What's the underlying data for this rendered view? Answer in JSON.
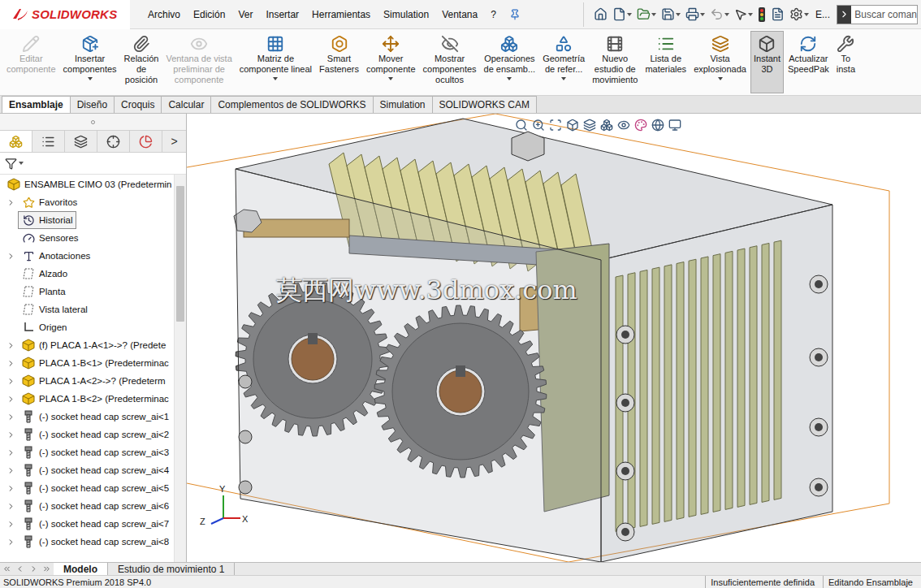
{
  "app": {
    "logo": "SOLIDWORKS"
  },
  "menu": [
    "Archivo",
    "Edición",
    "Ver",
    "Insertar",
    "Herramientas",
    "Simulation",
    "Ventana",
    "?"
  ],
  "quick_access": {
    "overflow_label": "E..."
  },
  "search": {
    "placeholder": "Buscar coman"
  },
  "ribbon": [
    {
      "lines": [
        "Editar",
        "componente"
      ],
      "disabled": true,
      "dropdown": false,
      "selected": false
    },
    {
      "lines": [
        "Insertar",
        "componentes"
      ],
      "disabled": false,
      "dropdown": true,
      "selected": false
    },
    {
      "lines": [
        "Relación",
        "de",
        "posición"
      ],
      "disabled": false,
      "dropdown": false,
      "selected": false
    },
    {
      "lines": [
        "Ventana de vista",
        "preliminar de",
        "componente"
      ],
      "disabled": true,
      "dropdown": false,
      "selected": false
    },
    {
      "lines": [
        "Matriz de",
        "componente lineal"
      ],
      "disabled": false,
      "dropdown": true,
      "selected": false
    },
    {
      "lines": [
        "Smart",
        "Fasteners"
      ],
      "disabled": false,
      "dropdown": false,
      "selected": false
    },
    {
      "lines": [
        "Mover",
        "componente"
      ],
      "disabled": false,
      "dropdown": true,
      "selected": false
    },
    {
      "lines": [
        "Mostrar",
        "componentes",
        "ocultos"
      ],
      "disabled": false,
      "dropdown": false,
      "selected": false
    },
    {
      "lines": [
        "Operaciones",
        "de ensamb..."
      ],
      "disabled": false,
      "dropdown": true,
      "selected": false
    },
    {
      "lines": [
        "Geometría",
        "de refer..."
      ],
      "disabled": false,
      "dropdown": true,
      "selected": false
    },
    {
      "lines": [
        "Nuevo",
        "estudio de",
        "movimiento"
      ],
      "disabled": false,
      "dropdown": false,
      "selected": false
    },
    {
      "lines": [
        "Lista de",
        "materiales"
      ],
      "disabled": false,
      "dropdown": false,
      "selected": false
    },
    {
      "lines": [
        "Vista",
        "explosionada"
      ],
      "disabled": false,
      "dropdown": true,
      "selected": false
    },
    {
      "lines": [
        "Instant",
        "3D"
      ],
      "disabled": false,
      "dropdown": false,
      "selected": true
    },
    {
      "lines": [
        "Actualizar",
        "SpeedPak"
      ],
      "disabled": false,
      "dropdown": false,
      "selected": false
    },
    {
      "lines": [
        "To",
        "insta"
      ],
      "disabled": false,
      "dropdown": false,
      "selected": false
    }
  ],
  "tabs": [
    {
      "label": "Ensamblaje",
      "selected": true
    },
    {
      "label": "Diseño",
      "selected": false
    },
    {
      "label": "Croquis",
      "selected": false
    },
    {
      "label": "Calcular",
      "selected": false
    },
    {
      "label": "Complementos de SOLIDWORKS",
      "selected": false
    },
    {
      "label": "Simulation",
      "selected": false
    },
    {
      "label": "SOLIDWORKS CAM",
      "selected": false
    }
  ],
  "panel": {
    "tabs": [
      {
        "selected": true
      },
      {
        "selected": false
      },
      {
        "selected": false
      },
      {
        "selected": false
      },
      {
        "selected": false
      }
    ],
    "more": ">",
    "scroll": {
      "level": 0.36
    },
    "tree": [
      {
        "label": "ENSAMBLE CIMO 03  (Predetermin",
        "kind": "assembly",
        "expandable": false,
        "selected": false
      },
      {
        "label": "Favoritos",
        "kind": "favorites",
        "expandable": true,
        "selected": false
      },
      {
        "label": "Historial",
        "kind": "history",
        "expandable": false,
        "selected": true
      },
      {
        "label": "Sensores",
        "kind": "sensors",
        "expandable": false,
        "selected": false
      },
      {
        "label": "Anotaciones",
        "kind": "annotations",
        "expandable": true,
        "selected": false
      },
      {
        "label": "Alzado",
        "kind": "plane",
        "expandable": false,
        "selected": false
      },
      {
        "label": "Planta",
        "kind": "plane",
        "expandable": false,
        "selected": false
      },
      {
        "label": "Vista lateral",
        "kind": "plane",
        "expandable": false,
        "selected": false
      },
      {
        "label": "Origen",
        "kind": "origin",
        "expandable": false,
        "selected": false
      },
      {
        "label": "(f) PLACA 1-A<1>->? (Predete",
        "kind": "part",
        "expandable": true,
        "selected": false
      },
      {
        "label": "PLACA 1-B<1> (Predeterminac",
        "kind": "part",
        "expandable": true,
        "selected": false
      },
      {
        "label": "PLACA 1-A<2>->? (Predeterm",
        "kind": "part",
        "expandable": true,
        "selected": false
      },
      {
        "label": "PLACA 1-B<2> (Predeterminac",
        "kind": "part",
        "expandable": true,
        "selected": false
      },
      {
        "label": "(-) socket head cap screw_ai<1",
        "kind": "screw",
        "expandable": true,
        "selected": false
      },
      {
        "label": "(-) socket head cap screw_ai<2",
        "kind": "screw",
        "expandable": true,
        "selected": false
      },
      {
        "label": "(-) socket head cap screw_ai<3",
        "kind": "screw",
        "expandable": true,
        "selected": false
      },
      {
        "label": "(-) socket head cap screw_ai<4",
        "kind": "screw",
        "expandable": true,
        "selected": false
      },
      {
        "label": "(-) socket head cap screw_ai<5",
        "kind": "screw",
        "expandable": true,
        "selected": false
      },
      {
        "label": "(-) socket head cap screw_ai<6",
        "kind": "screw",
        "expandable": true,
        "selected": false
      },
      {
        "label": "(-) socket head cap screw_ai<7",
        "kind": "screw",
        "expandable": true,
        "selected": false
      },
      {
        "label": "(-) socket head cap screw_ai<8",
        "kind": "screw",
        "expandable": true,
        "selected": false
      }
    ]
  },
  "viewport": {
    "watermark": "莫西网www.3dmox.com",
    "triad": {
      "x": "X",
      "y": "Y",
      "z": "Z"
    }
  },
  "bottom_tabs": [
    {
      "label": "Modelo",
      "selected": true
    },
    {
      "label": "Estudio de movimiento 1",
      "selected": false
    }
  ],
  "status_bar": {
    "product": "SOLIDWORKS Premium 2018 SP4.0",
    "fields": [
      "Insuficientemente definida",
      "Editando Ensamblaje"
    ]
  }
}
